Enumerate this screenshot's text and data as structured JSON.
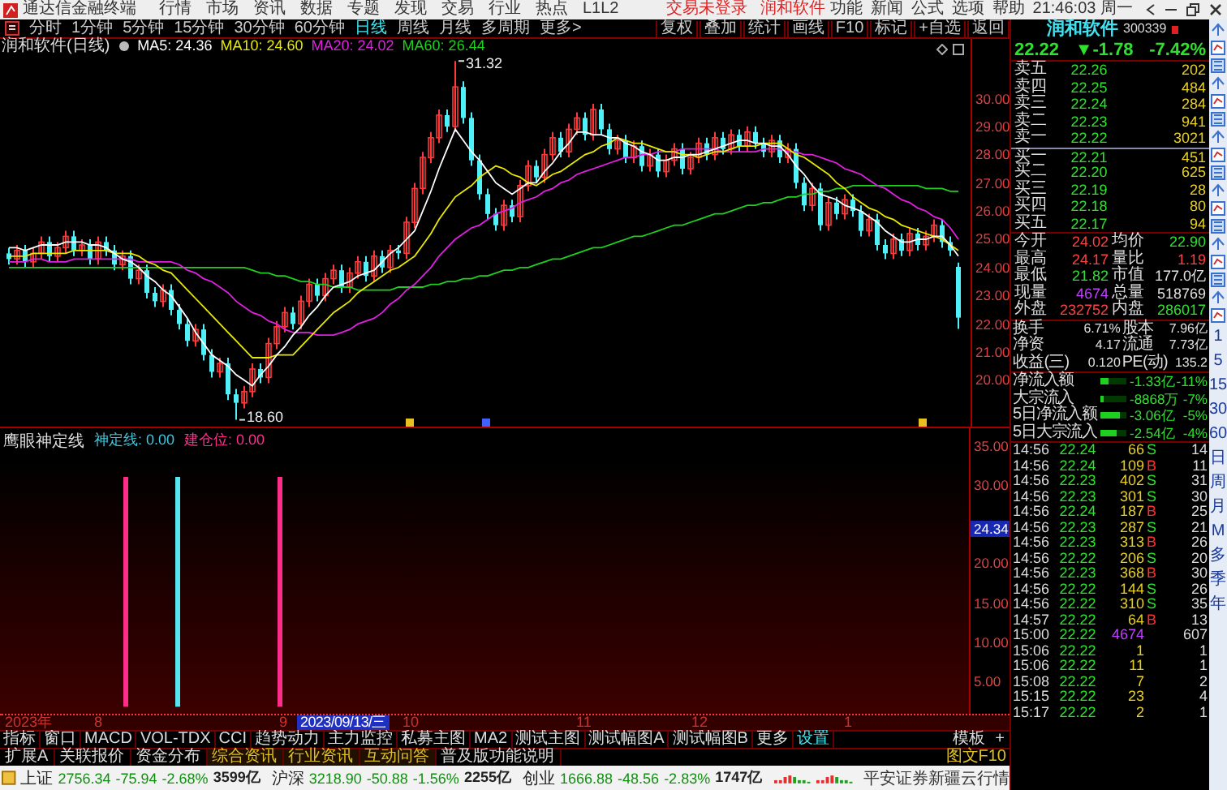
{
  "title_bar": {
    "app_name": "通达信金融终端",
    "menus": [
      "行情",
      "市场",
      "资讯",
      "数据",
      "专题",
      "发现",
      "交易",
      "行业",
      "热点",
      "L1L2"
    ],
    "notices": [
      "交易未登录",
      "润和软件"
    ],
    "tools": [
      "功能",
      "新闻",
      "公式",
      "选项",
      "帮助"
    ],
    "clock": "21:46:03 周一"
  },
  "toolbar": {
    "periods": [
      {
        "label": "分时",
        "selected": false
      },
      {
        "label": "1分钟",
        "selected": false
      },
      {
        "label": "5分钟",
        "selected": false
      },
      {
        "label": "15分钟",
        "selected": false
      },
      {
        "label": "30分钟",
        "selected": false
      },
      {
        "label": "60分钟",
        "selected": false
      },
      {
        "label": "日线",
        "selected": true
      },
      {
        "label": "周线",
        "selected": false
      },
      {
        "label": "月线",
        "selected": false
      },
      {
        "label": "多周期",
        "selected": false
      },
      {
        "label": "更多>",
        "selected": false
      }
    ],
    "tools": [
      "复权",
      "叠加",
      "统计",
      "画线",
      "F10",
      "标记",
      "+自选",
      "返回"
    ]
  },
  "chart": {
    "title": "润和软件(日线)",
    "high_label": "31.32",
    "low_label": "18.60",
    "chart_data": {
      "type": "candlestick",
      "ylim": [
        18.3,
        32.1
      ],
      "yticks": [
        {
          "value": 30,
          "label": "30.00"
        },
        {
          "value": 29,
          "label": "29.00"
        },
        {
          "value": 28,
          "label": "28.00"
        },
        {
          "value": 27,
          "label": "27.00"
        },
        {
          "value": 26,
          "label": "26.00"
        },
        {
          "value": 25,
          "label": "25.00"
        },
        {
          "value": 24,
          "label": "24.00"
        },
        {
          "value": 23,
          "label": "23.00"
        },
        {
          "value": 22,
          "label": "22.00"
        },
        {
          "value": 21,
          "label": "21.00"
        },
        {
          "value": 20,
          "label": "20.00"
        }
      ],
      "categories": [
        null,
        null,
        null,
        null,
        null,
        null,
        null,
        null,
        null,
        null,
        null,
        null,
        null,
        null,
        null,
        null,
        null,
        null,
        null,
        null,
        null,
        null,
        null,
        null,
        null,
        null,
        null,
        null,
        null,
        null,
        null,
        null,
        null,
        null,
        null,
        null,
        null,
        null,
        null,
        null,
        null,
        null,
        null,
        null,
        null,
        null,
        null,
        null,
        null,
        null,
        null,
        null,
        null,
        null,
        null,
        null,
        null,
        null,
        null,
        null,
        null,
        null,
        null,
        null,
        null,
        null,
        null,
        null,
        null,
        null,
        null,
        null,
        null,
        null,
        null,
        null,
        null,
        null,
        null,
        null,
        null,
        null,
        null,
        null,
        null,
        null,
        null,
        null,
        null,
        null,
        null,
        null,
        null,
        null,
        null,
        null,
        null,
        null,
        null,
        null,
        null,
        null,
        null,
        null,
        null,
        null,
        null,
        null,
        null,
        null,
        null,
        null,
        null,
        null,
        null,
        null,
        null,
        null
      ],
      "ohlc": [
        [
          24.5,
          24.7,
          24.1,
          24.3
        ],
        [
          24.3,
          24.8,
          24.1,
          24.6
        ],
        [
          24.6,
          24.8,
          24.0,
          24.2
        ],
        [
          24.2,
          24.7,
          24.0,
          24.5
        ],
        [
          24.5,
          25.1,
          24.3,
          24.9
        ],
        [
          24.9,
          25.1,
          24.2,
          24.4
        ],
        [
          24.4,
          24.9,
          24.2,
          24.7
        ],
        [
          24.7,
          25.3,
          24.5,
          25.1
        ],
        [
          25.1,
          25.3,
          24.4,
          24.6
        ],
        [
          24.6,
          25.0,
          24.4,
          24.8
        ],
        [
          24.8,
          25.0,
          24.1,
          24.3
        ],
        [
          24.3,
          25.1,
          24.1,
          24.9
        ],
        [
          24.9,
          25.1,
          24.4,
          24.6
        ],
        [
          24.6,
          24.8,
          23.9,
          24.1
        ],
        [
          24.1,
          24.6,
          23.9,
          24.4
        ],
        [
          24.4,
          24.6,
          23.4,
          23.6
        ],
        [
          23.6,
          24.1,
          23.4,
          23.9
        ],
        [
          23.9,
          24.1,
          22.9,
          23.1
        ],
        [
          23.1,
          23.3,
          22.6,
          22.8
        ],
        [
          22.8,
          23.4,
          22.6,
          23.2
        ],
        [
          23.2,
          23.4,
          22.3,
          22.5
        ],
        [
          22.5,
          22.7,
          21.8,
          22.0
        ],
        [
          22.0,
          22.2,
          21.2,
          21.4
        ],
        [
          21.4,
          22.0,
          21.2,
          21.8
        ],
        [
          21.8,
          22.0,
          20.7,
          20.9
        ],
        [
          20.9,
          21.1,
          20.1,
          20.3
        ],
        [
          20.3,
          20.8,
          20.1,
          20.6
        ],
        [
          20.6,
          20.8,
          19.3,
          19.5
        ],
        [
          19.5,
          19.7,
          18.6,
          19.2
        ],
        [
          19.2,
          19.8,
          19.0,
          19.6
        ],
        [
          19.6,
          20.6,
          19.4,
          20.4
        ],
        [
          20.4,
          20.6,
          19.9,
          20.1
        ],
        [
          20.1,
          21.5,
          19.9,
          21.3
        ],
        [
          21.3,
          22.1,
          21.1,
          21.9
        ],
        [
          21.9,
          22.6,
          21.7,
          22.4
        ],
        [
          22.4,
          22.6,
          21.8,
          22.0
        ],
        [
          22.0,
          23.0,
          21.8,
          22.8
        ],
        [
          22.8,
          23.6,
          22.6,
          23.4
        ],
        [
          23.4,
          23.6,
          22.8,
          23.0
        ],
        [
          23.0,
          23.8,
          22.8,
          23.6
        ],
        [
          23.6,
          24.1,
          23.4,
          23.9
        ],
        [
          23.9,
          24.1,
          23.1,
          23.3
        ],
        [
          23.3,
          24.0,
          23.1,
          23.8
        ],
        [
          23.8,
          24.4,
          23.6,
          24.2
        ],
        [
          24.2,
          24.4,
          23.5,
          23.7
        ],
        [
          23.7,
          24.6,
          23.5,
          24.4
        ],
        [
          24.4,
          24.6,
          23.8,
          24.0
        ],
        [
          24.0,
          24.8,
          23.8,
          24.6
        ],
        [
          24.6,
          24.8,
          24.3,
          24.5
        ],
        [
          24.5,
          25.8,
          24.3,
          25.6
        ],
        [
          25.6,
          27.0,
          25.4,
          26.8
        ],
        [
          26.8,
          28.1,
          26.6,
          27.9
        ],
        [
          27.9,
          28.8,
          27.7,
          28.6
        ],
        [
          28.6,
          29.6,
          28.4,
          29.4
        ],
        [
          29.4,
          29.6,
          28.8,
          29.0
        ],
        [
          29.0,
          31.32,
          28.8,
          30.4
        ],
        [
          30.4,
          30.6,
          29.1,
          29.3
        ],
        [
          29.3,
          29.5,
          27.6,
          27.8
        ],
        [
          27.8,
          28.0,
          26.4,
          26.6
        ],
        [
          26.6,
          26.8,
          25.7,
          25.9
        ],
        [
          25.9,
          26.1,
          25.3,
          25.5
        ],
        [
          25.5,
          26.4,
          25.3,
          26.2
        ],
        [
          26.2,
          26.4,
          25.6,
          25.8
        ],
        [
          25.8,
          27.1,
          25.6,
          26.9
        ],
        [
          26.9,
          27.8,
          26.7,
          27.6
        ],
        [
          27.6,
          27.8,
          27.0,
          27.2
        ],
        [
          27.2,
          28.2,
          27.0,
          28.0
        ],
        [
          28.0,
          28.8,
          27.8,
          28.6
        ],
        [
          28.6,
          28.8,
          27.9,
          28.1
        ],
        [
          28.1,
          29.1,
          27.9,
          28.9
        ],
        [
          28.9,
          29.5,
          28.7,
          29.3
        ],
        [
          29.3,
          29.5,
          28.5,
          28.7
        ],
        [
          28.7,
          29.8,
          28.5,
          29.6
        ],
        [
          29.6,
          29.8,
          28.7,
          28.9
        ],
        [
          28.9,
          29.1,
          28.0,
          28.2
        ],
        [
          28.2,
          28.7,
          28.0,
          28.5
        ],
        [
          28.5,
          28.7,
          27.7,
          27.9
        ],
        [
          27.9,
          28.5,
          27.7,
          28.3
        ],
        [
          28.3,
          28.5,
          27.4,
          27.6
        ],
        [
          27.6,
          28.2,
          27.4,
          28.0
        ],
        [
          28.0,
          28.2,
          27.2,
          27.4
        ],
        [
          27.4,
          28.0,
          27.2,
          27.8
        ],
        [
          27.8,
          28.4,
          27.6,
          28.2
        ],
        [
          28.2,
          28.4,
          27.3,
          27.5
        ],
        [
          27.5,
          28.1,
          27.3,
          27.9
        ],
        [
          27.9,
          28.6,
          27.7,
          28.4
        ],
        [
          28.4,
          28.6,
          27.8,
          28.0
        ],
        [
          28.0,
          28.8,
          27.8,
          28.6
        ],
        [
          28.6,
          28.8,
          28.0,
          28.2
        ],
        [
          28.2,
          28.9,
          28.0,
          28.7
        ],
        [
          28.7,
          28.9,
          28.1,
          28.3
        ],
        [
          28.3,
          29.0,
          28.1,
          28.8
        ],
        [
          28.8,
          29.0,
          28.2,
          28.4
        ],
        [
          28.4,
          28.6,
          27.9,
          28.1
        ],
        [
          28.1,
          28.7,
          27.9,
          28.5
        ],
        [
          28.5,
          28.7,
          27.7,
          27.9
        ],
        [
          27.9,
          28.4,
          27.7,
          28.2
        ],
        [
          28.2,
          28.4,
          26.8,
          27.0
        ],
        [
          27.0,
          27.2,
          26.0,
          26.2
        ],
        [
          26.2,
          27.0,
          26.0,
          26.8
        ],
        [
          26.8,
          27.0,
          25.3,
          25.5
        ],
        [
          25.5,
          26.5,
          25.3,
          26.3
        ],
        [
          26.3,
          26.5,
          25.7,
          25.9
        ],
        [
          25.9,
          26.6,
          25.7,
          26.4
        ],
        [
          26.4,
          26.6,
          25.8,
          26.0
        ],
        [
          26.0,
          26.2,
          25.1,
          25.3
        ],
        [
          25.3,
          25.9,
          25.1,
          25.7
        ],
        [
          25.7,
          25.9,
          24.6,
          24.8
        ],
        [
          24.8,
          25.0,
          24.3,
          24.5
        ],
        [
          24.5,
          25.2,
          24.3,
          25.0
        ],
        [
          25.0,
          25.2,
          24.4,
          24.6
        ],
        [
          24.6,
          25.4,
          24.4,
          25.2
        ],
        [
          25.2,
          25.4,
          24.6,
          24.8
        ],
        [
          24.8,
          25.3,
          24.6,
          25.1
        ],
        [
          25.1,
          25.7,
          24.9,
          25.5
        ],
        [
          25.5,
          25.7,
          24.7,
          24.9
        ],
        [
          24.9,
          25.1,
          24.4,
          24.6
        ],
        [
          24.02,
          24.17,
          21.82,
          22.22
        ]
      ],
      "series": [
        {
          "name": "MA5: 24.36",
          "type": "line",
          "color": "#ffffff",
          "values": [
            24.7,
            24.7,
            24.6,
            24.7,
            24.8,
            24.8,
            24.8,
            24.9,
            24.9,
            24.9,
            24.8,
            24.8,
            24.7,
            24.5,
            24.3,
            24.2,
            24.0,
            23.7,
            23.5,
            23.2,
            23.0,
            22.6,
            22.2,
            21.7,
            21.3,
            20.9,
            20.7,
            20.5,
            20.2,
            20.0,
            19.8,
            20.2,
            20.5,
            20.9,
            21.2,
            21.6,
            21.9,
            22.3,
            22.6,
            23.0,
            23.3,
            23.4,
            23.5,
            23.7,
            23.8,
            23.9,
            24.2,
            24.5,
            24.7,
            25.0,
            25.3,
            26.0,
            26.7,
            27.5,
            28.2,
            28.9,
            28.5,
            28.1,
            27.8,
            27.4,
            27.0,
            26.8,
            26.6,
            26.8,
            27.0,
            27.0,
            27.4,
            27.7,
            28.1,
            28.4,
            28.8,
            28.8,
            28.7,
            28.7,
            28.6,
            28.6,
            28.4,
            28.3,
            28.1,
            28.0,
            27.8,
            27.8,
            27.9,
            27.9,
            28.0,
            28.0,
            28.1,
            28.2,
            28.3,
            28.4,
            28.5,
            28.5,
            28.4,
            28.4,
            28.3,
            28.3,
            28.0,
            27.6,
            27.3,
            26.9,
            26.6,
            26.5,
            26.4,
            26.2,
            26.1,
            26.0,
            25.8,
            25.6,
            25.3,
            25.1,
            24.9,
            24.9,
            25.0,
            25.0,
            25.1,
            25.1,
            24.8,
            24.4
          ]
        },
        {
          "name": "MA10: 24.60",
          "type": "line",
          "color": "#e8e800",
          "values": [
            24.4,
            24.4,
            24.4,
            24.5,
            24.5,
            24.5,
            24.5,
            24.5,
            24.6,
            24.6,
            24.6,
            24.6,
            24.6,
            24.5,
            24.5,
            24.5,
            24.4,
            24.2,
            24.1,
            23.9,
            23.8,
            23.5,
            23.2,
            22.9,
            22.6,
            22.3,
            22.0,
            21.7,
            21.4,
            21.1,
            20.8,
            20.8,
            20.8,
            20.9,
            20.9,
            20.9,
            21.2,
            21.5,
            21.8,
            22.1,
            22.4,
            22.6,
            22.8,
            23.1,
            23.3,
            23.5,
            23.7,
            23.9,
            24.0,
            24.2,
            24.4,
            24.8,
            25.2,
            25.7,
            26.1,
            26.5,
            26.7,
            26.9,
            27.2,
            27.4,
            27.6,
            27.5,
            27.3,
            27.2,
            27.0,
            26.9,
            27.1,
            27.3,
            27.4,
            27.6,
            27.8,
            28.0,
            28.1,
            28.3,
            28.4,
            28.6,
            28.5,
            28.4,
            28.4,
            28.3,
            28.2,
            28.1,
            28.1,
            28.0,
            28.0,
            27.9,
            28.0,
            28.1,
            28.1,
            28.2,
            28.3,
            28.3,
            28.3,
            28.4,
            28.4,
            28.4,
            28.2,
            28.0,
            27.9,
            27.7,
            27.5,
            27.3,
            27.0,
            26.8,
            26.5,
            26.3,
            26.1,
            26.0,
            25.8,
            25.7,
            25.5,
            25.4,
            25.3,
            25.2,
            25.1,
            25.0,
            24.8,
            24.6
          ]
        },
        {
          "name": "MA20: 24.02",
          "type": "line",
          "color": "#e020e0",
          "values": [
            24.2,
            24.2,
            24.2,
            24.3,
            24.3,
            24.2,
            24.2,
            24.2,
            24.3,
            24.3,
            24.3,
            24.3,
            24.3,
            24.3,
            24.3,
            24.3,
            24.2,
            24.2,
            24.2,
            24.2,
            24.2,
            24.1,
            23.9,
            23.8,
            23.6,
            23.5,
            23.3,
            23.1,
            22.8,
            22.6,
            22.4,
            22.3,
            22.1,
            22.0,
            21.8,
            21.7,
            21.7,
            21.7,
            21.6,
            21.6,
            21.6,
            21.7,
            21.8,
            22.0,
            22.1,
            22.2,
            22.4,
            22.7,
            22.9,
            23.2,
            23.4,
            23.7,
            24.0,
            24.4,
            24.7,
            25.0,
            25.2,
            25.4,
            25.5,
            25.7,
            25.9,
            26.0,
            26.1,
            26.3,
            26.4,
            26.5,
            26.7,
            26.8,
            27.0,
            27.1,
            27.3,
            27.4,
            27.5,
            27.6,
            27.7,
            27.8,
            27.9,
            27.9,
            28.0,
            28.0,
            28.1,
            28.1,
            28.1,
            28.2,
            28.2,
            28.2,
            28.2,
            28.2,
            28.1,
            28.1,
            28.1,
            28.1,
            28.1,
            28.2,
            28.2,
            28.2,
            28.1,
            28.1,
            28.0,
            28.0,
            27.9,
            27.8,
            27.7,
            27.5,
            27.4,
            27.3,
            27.1,
            26.9,
            26.8,
            26.6,
            26.4,
            26.3,
            26.1,
            26.0,
            25.8,
            25.7,
            25.4,
            25.0
          ]
        },
        {
          "name": "MA60: 26.44",
          "type": "line",
          "color": "#20d020",
          "values": [
            24.0,
            24.0,
            24.0,
            24.0,
            24.0,
            24.0,
            24.0,
            24.0,
            24.0,
            24.0,
            24.0,
            24.0,
            24.0,
            24.0,
            24.0,
            24.0,
            24.0,
            24.0,
            24.0,
            24.0,
            24.0,
            24.0,
            24.0,
            24.0,
            24.0,
            24.0,
            24.0,
            24.0,
            24.0,
            24.0,
            23.9,
            23.8,
            23.8,
            23.7,
            23.7,
            23.6,
            23.5,
            23.5,
            23.4,
            23.4,
            23.3,
            23.3,
            23.3,
            23.2,
            23.2,
            23.2,
            23.2,
            23.2,
            23.3,
            23.3,
            23.3,
            23.3,
            23.4,
            23.4,
            23.5,
            23.5,
            23.6,
            23.6,
            23.7,
            23.7,
            23.8,
            23.9,
            23.9,
            24.0,
            24.0,
            24.1,
            24.2,
            24.3,
            24.3,
            24.4,
            24.5,
            24.6,
            24.7,
            24.7,
            24.8,
            24.9,
            25.0,
            25.1,
            25.1,
            25.2,
            25.3,
            25.4,
            25.5,
            25.5,
            25.6,
            25.7,
            25.8,
            25.9,
            25.9,
            26.0,
            26.1,
            26.2,
            26.2,
            26.3,
            26.3,
            26.4,
            26.5,
            26.5,
            26.6,
            26.6,
            26.7,
            26.7,
            26.8,
            26.8,
            26.9,
            26.9,
            26.9,
            26.9,
            26.9,
            26.9,
            26.9,
            26.9,
            26.9,
            26.8,
            26.8,
            26.8,
            26.7,
            26.7
          ]
        }
      ]
    }
  },
  "indicator": {
    "name": "鹰眼神定线",
    "values": [
      {
        "label": "神定线: 0.00",
        "color": "#40c8e0"
      },
      {
        "label": "建仓位: 0.00",
        "color": "#ff3090"
      }
    ],
    "ticks": [
      "35.00",
      "30.00",
      "20.00",
      "15.00",
      "10.00",
      "5.00"
    ],
    "cursor_value": "24.34"
  },
  "date_axis": {
    "labels": [
      "2023年",
      "8",
      "9",
      "10",
      "11",
      "12",
      "1"
    ],
    "cursor_date": "2023/09/13/三"
  },
  "indicator_tabs": [
    {
      "label": "指标",
      "selected": false
    },
    {
      "label": "窗口",
      "selected": false
    },
    {
      "label": "MACD",
      "selected": false
    },
    {
      "label": "VOL-TDX",
      "selected": false
    },
    {
      "label": "CCI",
      "selected": false
    },
    {
      "label": "趋势动力",
      "selected": false
    },
    {
      "label": "主力监控",
      "selected": false
    },
    {
      "label": "私募主图",
      "selected": false
    },
    {
      "label": "MA2",
      "selected": false
    },
    {
      "label": "测试主图",
      "selected": false
    },
    {
      "label": "测试幅图A",
      "selected": false
    },
    {
      "label": "测试幅图B",
      "selected": false
    },
    {
      "label": "更多",
      "selected": false
    },
    {
      "label": "设置",
      "selected": true
    }
  ],
  "template_buttons": [
    "模板",
    "+"
  ],
  "extension_tabs": [
    {
      "label": "扩展A",
      "highlighted": false
    },
    {
      "label": "关联报价",
      "highlighted": false
    },
    {
      "label": "资金分布",
      "highlighted": false
    },
    {
      "label": "综合资讯",
      "highlighted": true
    },
    {
      "label": "行业资讯",
      "highlighted": true
    },
    {
      "label": "互动问答",
      "highlighted": true
    },
    {
      "label": "普及版功能说明",
      "highlighted": false
    }
  ],
  "f10_link": "图文F10",
  "status_bar": {
    "indices": [
      {
        "name": "上证",
        "value": "2756.34",
        "change": "-75.94",
        "pct": "-2.68%",
        "amount": "3599亿"
      },
      {
        "name": "沪深",
        "value": "3218.90",
        "change": "-50.88",
        "pct": "-1.56%",
        "amount": "2255亿"
      },
      {
        "name": "创业",
        "value": "1666.88",
        "change": "-48.56",
        "pct": "-2.83%",
        "amount": "1747亿"
      }
    ],
    "broker": "平安证券新疆云行情"
  },
  "quote": {
    "name": "润和软件",
    "code": "300339",
    "price": "22.22",
    "change": "▼-1.78",
    "pct": "-7.42%",
    "asks": [
      {
        "label": "卖五",
        "price": "22.26",
        "volume": "202"
      },
      {
        "label": "卖四",
        "price": "22.25",
        "volume": "484"
      },
      {
        "label": "卖三",
        "price": "22.24",
        "volume": "284"
      },
      {
        "label": "卖二",
        "price": "22.23",
        "volume": "941"
      },
      {
        "label": "卖一",
        "price": "22.22",
        "volume": "3021"
      }
    ],
    "bids": [
      {
        "label": "买一",
        "price": "22.21",
        "volume": "451"
      },
      {
        "label": "买二",
        "price": "22.20",
        "volume": "625"
      },
      {
        "label": "买三",
        "price": "22.19",
        "volume": "28"
      },
      {
        "label": "买四",
        "price": "22.18",
        "volume": "80"
      },
      {
        "label": "买五",
        "price": "22.17",
        "volume": "94"
      }
    ],
    "stats": [
      {
        "label": "今开",
        "value": "24.02",
        "color": "#ff4040"
      },
      {
        "label": "均价",
        "value": "22.90",
        "color": "#30e030"
      },
      {
        "label": "最高",
        "value": "24.17",
        "color": "#ff4040"
      },
      {
        "label": "量比",
        "value": "1.19",
        "color": "#ff4040"
      },
      {
        "label": "最低",
        "value": "21.82",
        "color": "#30e030"
      },
      {
        "label": "市值",
        "value": "177.0亿",
        "color": "#e0e0e0"
      },
      {
        "label": "现量",
        "value": "4674",
        "color": "#c040ff"
      },
      {
        "label": "总量",
        "value": "518769",
        "color": "#e0e0e0"
      },
      {
        "label": "外盘",
        "value": "232752",
        "color": "#ff4040"
      },
      {
        "label": "内盘",
        "value": "286017",
        "color": "#30e030"
      }
    ],
    "fundamentals": [
      {
        "label": "换手",
        "value": "6.71%"
      },
      {
        "label": "股本",
        "value": "7.96亿"
      },
      {
        "label": "净资",
        "value": "4.17"
      },
      {
        "label": "流通",
        "value": "7.73亿"
      },
      {
        "label": "收益(三)",
        "value": "0.120"
      },
      {
        "label": "PE(动)",
        "value": "135.2"
      }
    ],
    "flows": [
      {
        "label": "净流入额",
        "level": 0.3,
        "value": "-1.33亿",
        "pct": "-11%"
      },
      {
        "label": "大宗流入",
        "level": 0.15,
        "value": "-8868万",
        "pct": "-7%"
      },
      {
        "label": "5日净流入额",
        "level": 0.75,
        "value": "-3.06亿",
        "pct": "-5%"
      },
      {
        "label": "5日大宗流入",
        "level": 0.6,
        "value": "-2.54亿",
        "pct": "-4%"
      }
    ],
    "ticks": [
      {
        "time": "14:56",
        "price": "22.24",
        "volume": "66",
        "side": "S",
        "count": "14"
      },
      {
        "time": "14:56",
        "price": "22.24",
        "volume": "109",
        "side": "B",
        "count": "11"
      },
      {
        "time": "14:56",
        "price": "22.23",
        "volume": "402",
        "side": "S",
        "count": "31"
      },
      {
        "time": "14:56",
        "price": "22.23",
        "volume": "301",
        "side": "S",
        "count": "30"
      },
      {
        "time": "14:56",
        "price": "22.24",
        "volume": "187",
        "side": "B",
        "count": "25"
      },
      {
        "time": "14:56",
        "price": "22.23",
        "volume": "287",
        "side": "S",
        "count": "21"
      },
      {
        "time": "14:56",
        "price": "22.23",
        "volume": "313",
        "side": "B",
        "count": "26"
      },
      {
        "time": "14:56",
        "price": "22.22",
        "volume": "206",
        "side": "S",
        "count": "20"
      },
      {
        "time": "14:56",
        "price": "22.23",
        "volume": "368",
        "side": "B",
        "count": "30"
      },
      {
        "time": "14:56",
        "price": "22.22",
        "volume": "144",
        "side": "S",
        "count": "26"
      },
      {
        "time": "14:56",
        "price": "22.22",
        "volume": "310",
        "side": "S",
        "count": "35"
      },
      {
        "time": "14:57",
        "price": "22.22",
        "volume": "64",
        "side": "B",
        "count": "13"
      },
      {
        "time": "15:00",
        "price": "22.22",
        "volume": "4674",
        "count": "607",
        "kind": "closing"
      },
      {
        "time": "15:06",
        "price": "22.22",
        "volume": "1",
        "count": "1"
      },
      {
        "time": "15:06",
        "price": "22.22",
        "volume": "11",
        "count": "1"
      },
      {
        "time": "15:08",
        "price": "22.22",
        "volume": "7",
        "count": "2"
      },
      {
        "time": "15:15",
        "price": "22.22",
        "volume": "23",
        "count": "4"
      },
      {
        "time": "15:17",
        "price": "22.22",
        "volume": "2",
        "count": "1"
      }
    ]
  },
  "period_shortcuts": [
    "1",
    "5",
    "15",
    "30",
    "60",
    "日",
    "周",
    "月",
    "M",
    "多",
    "季",
    "年"
  ]
}
